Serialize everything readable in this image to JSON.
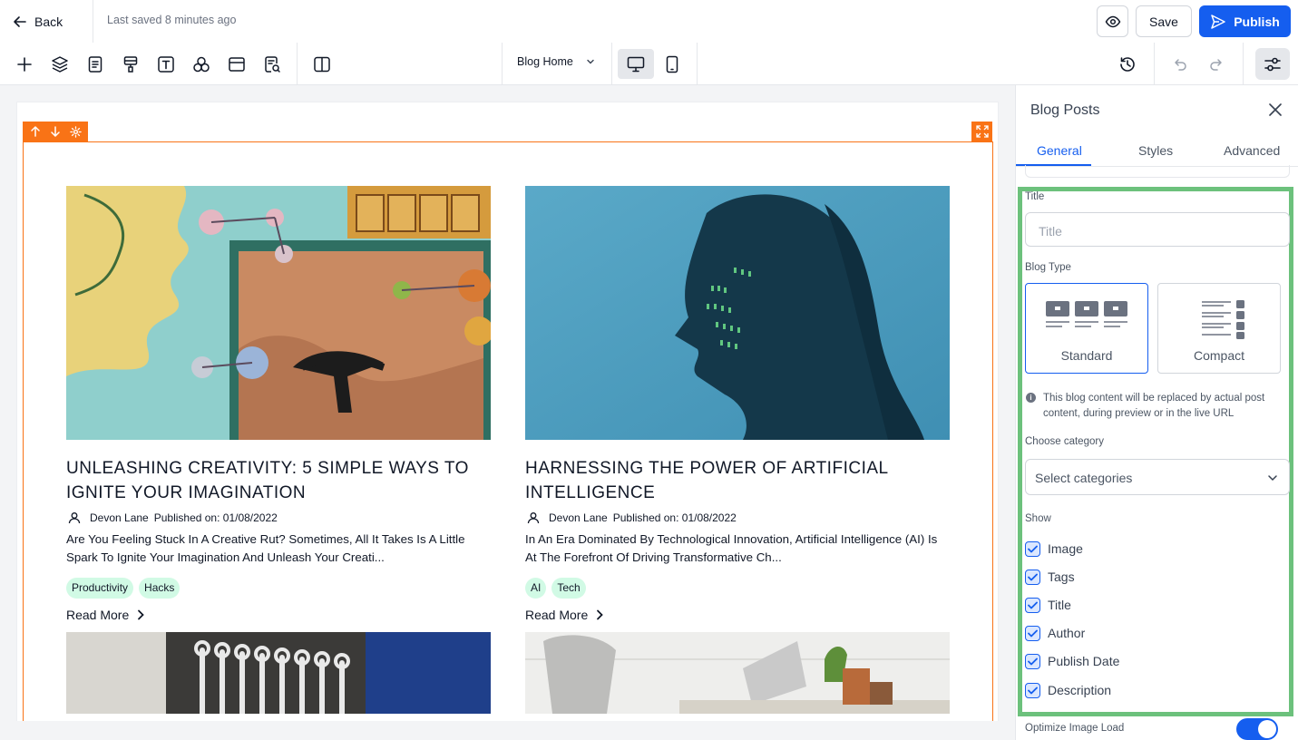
{
  "topbar": {
    "back_label": "Back",
    "saved_status": "Last saved 8 minutes ago",
    "save_label": "Save",
    "publish_label": "Publish"
  },
  "toolbar": {
    "page_name": "Blog Home",
    "icons": [
      "plus-icon",
      "layers-icon",
      "pages-icon",
      "paint-icon",
      "text-icon",
      "elements-icon",
      "layout-icon",
      "page-search-icon",
      "split-view-icon"
    ]
  },
  "canvas": {
    "posts": [
      {
        "title": "Unleashing Creativity: 5 Simple Ways To Ignite Your Imagination",
        "author": "Devon Lane",
        "published": "Published on: 01/08/2022",
        "description": "Are You Feeling Stuck In A Creative Rut? Sometimes, All It Takes Is A Little Spark To Ignite Your Imagination And Unleash Your Creati...",
        "tags": [
          "Productivity",
          "Hacks"
        ],
        "read_more": "Read More"
      },
      {
        "title": "Harnessing The Power Of Artificial Intelligence",
        "author": "Devon Lane",
        "published": "Published on: 01/08/2022",
        "description": "In An Era Dominated By Technological Innovation, Artificial Intelligence (AI) Is At The Forefront Of Driving Transformative Ch...",
        "tags": [
          "AI",
          "Tech"
        ],
        "read_more": "Read More"
      }
    ]
  },
  "panel": {
    "title": "Blog Posts",
    "tabs": [
      "General",
      "Styles",
      "Advanced"
    ],
    "active_tab": "General",
    "title_label": "Title",
    "title_placeholder": "Title",
    "blog_type_label": "Blog Type",
    "blog_types": [
      "Standard",
      "Compact"
    ],
    "selected_blog_type": "Standard",
    "info_text": "This blog content will be replaced by actual post content, during preview or in the live URL",
    "category_label": "Choose category",
    "category_placeholder": "Select categories",
    "show_label": "Show",
    "show_items": [
      "Image",
      "Tags",
      "Title",
      "Author",
      "Publish Date",
      "Description"
    ],
    "optimize_label": "Optimize Image Load"
  },
  "colors": {
    "primary": "#155eef",
    "section_highlight": "#f97316",
    "panel_highlight": "#6cc17c",
    "tag_bg": "#d1fae5"
  }
}
